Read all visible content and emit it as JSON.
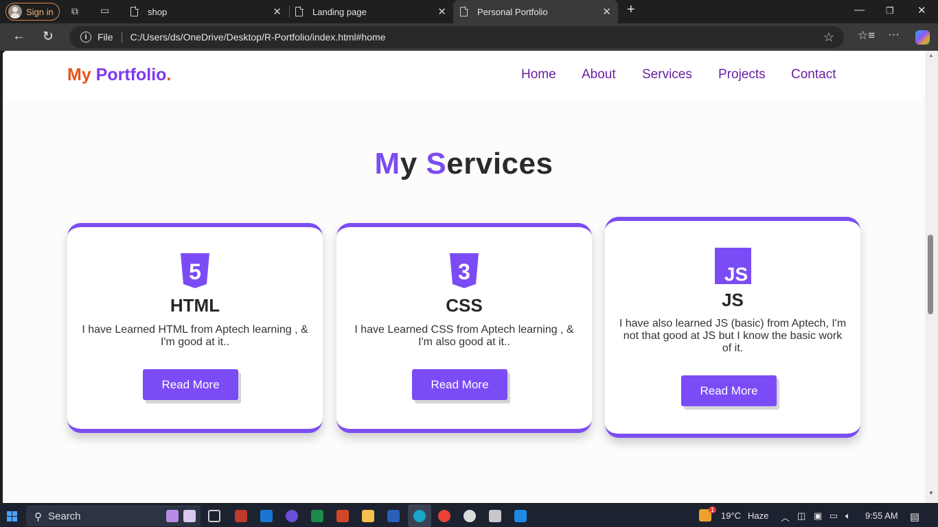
{
  "browser": {
    "signin_label": "Sign in",
    "tabs": [
      {
        "title": "shop",
        "close": "✕"
      },
      {
        "title": "Landing page",
        "close": "✕"
      },
      {
        "title": "Personal Portfolio",
        "close": "✕"
      }
    ],
    "new_tab": "+",
    "window": {
      "minimize": "—",
      "restore": "❐",
      "close": "✕"
    },
    "address": {
      "scheme_label": "File",
      "url": "C:/Users/ds/OneDrive/Desktop/R-Portfolio/index.html#home"
    },
    "back": "←",
    "reload": "↻",
    "more": "···",
    "scroll_position": 0.33
  },
  "site": {
    "logo": {
      "part1": "My",
      "part2": " Portfolio",
      "part3": "."
    },
    "nav": [
      "Home",
      "About",
      "Services",
      "Projects",
      "Contact"
    ],
    "section_title": {
      "hl1": "M",
      "rest1": "y ",
      "hl2": "S",
      "rest2": "ervices"
    },
    "cards": [
      {
        "icon": "html5-icon",
        "icon_glyph": "5",
        "title": "HTML",
        "text": "I have Learned HTML from Aptech learning , & I'm good at it..",
        "button": "Read More"
      },
      {
        "icon": "css3-icon",
        "icon_glyph": "3",
        "title": "CSS",
        "text": "I have Learned CSS from Aptech learning , & I'm also good at it..",
        "button": "Read More"
      },
      {
        "icon": "js-icon",
        "icon_glyph": "JS",
        "title": "JS",
        "text": "I have also learned JS (basic) from Aptech, I'm not that good at JS but I know the basic work of it.",
        "button": "Read More"
      }
    ],
    "colors": {
      "accent": "#7b4cf5",
      "logo_orange": "#e8541a",
      "nav": "#6a1fa0"
    }
  },
  "taskbar": {
    "search_placeholder": "Search",
    "weather_temp": "19°C",
    "weather_text": "Haze",
    "time": "9:55 AM",
    "notification_badge": "1"
  }
}
